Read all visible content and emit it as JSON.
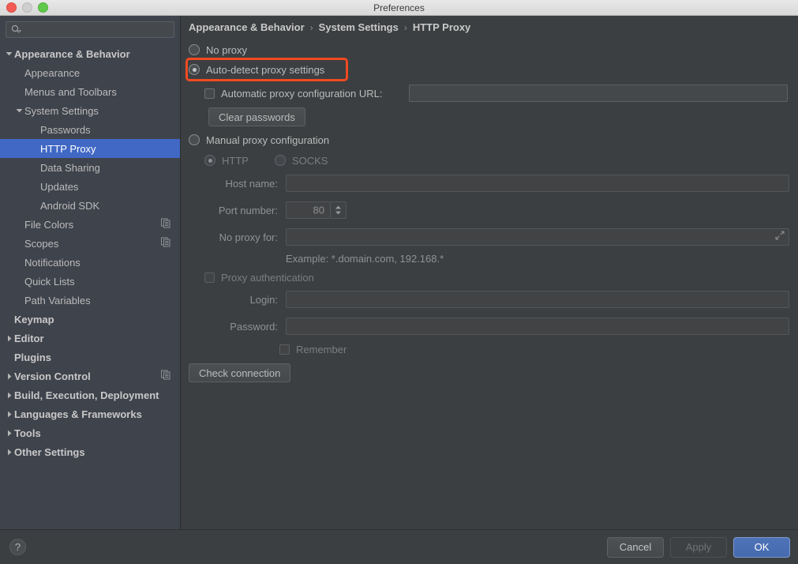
{
  "window": {
    "title": "Preferences",
    "traffic_lights": [
      "close-button",
      "minimize-button",
      "maximize-button"
    ]
  },
  "sidebar": {
    "search": {
      "placeholder": "",
      "value": "",
      "icon": "search-icon"
    },
    "items": [
      {
        "label": "Appearance & Behavior",
        "indent": 0,
        "bold": true,
        "twisty": "down",
        "selected": false,
        "badge": false
      },
      {
        "label": "Appearance",
        "indent": 1,
        "bold": false,
        "twisty": "none",
        "selected": false,
        "badge": false
      },
      {
        "label": "Menus and Toolbars",
        "indent": 1,
        "bold": false,
        "twisty": "none",
        "selected": false,
        "badge": false
      },
      {
        "label": "System Settings",
        "indent": 1,
        "bold": false,
        "twisty": "down",
        "selected": false,
        "badge": false
      },
      {
        "label": "Passwords",
        "indent": 2,
        "bold": false,
        "twisty": "none",
        "selected": false,
        "badge": false
      },
      {
        "label": "HTTP Proxy",
        "indent": 2,
        "bold": false,
        "twisty": "none",
        "selected": true,
        "badge": false
      },
      {
        "label": "Data Sharing",
        "indent": 2,
        "bold": false,
        "twisty": "none",
        "selected": false,
        "badge": false
      },
      {
        "label": "Updates",
        "indent": 2,
        "bold": false,
        "twisty": "none",
        "selected": false,
        "badge": false
      },
      {
        "label": "Android SDK",
        "indent": 2,
        "bold": false,
        "twisty": "none",
        "selected": false,
        "badge": false
      },
      {
        "label": "File Colors",
        "indent": 1,
        "bold": false,
        "twisty": "none",
        "selected": false,
        "badge": true
      },
      {
        "label": "Scopes",
        "indent": 1,
        "bold": false,
        "twisty": "none",
        "selected": false,
        "badge": true
      },
      {
        "label": "Notifications",
        "indent": 1,
        "bold": false,
        "twisty": "none",
        "selected": false,
        "badge": false
      },
      {
        "label": "Quick Lists",
        "indent": 1,
        "bold": false,
        "twisty": "none",
        "selected": false,
        "badge": false
      },
      {
        "label": "Path Variables",
        "indent": 1,
        "bold": false,
        "twisty": "none",
        "selected": false,
        "badge": false
      },
      {
        "label": "Keymap",
        "indent": 0,
        "bold": true,
        "twisty": "none",
        "selected": false,
        "badge": false
      },
      {
        "label": "Editor",
        "indent": 0,
        "bold": true,
        "twisty": "right",
        "selected": false,
        "badge": false
      },
      {
        "label": "Plugins",
        "indent": 0,
        "bold": true,
        "twisty": "none",
        "selected": false,
        "badge": false
      },
      {
        "label": "Version Control",
        "indent": 0,
        "bold": true,
        "twisty": "right",
        "selected": false,
        "badge": true
      },
      {
        "label": "Build, Execution, Deployment",
        "indent": 0,
        "bold": true,
        "twisty": "right",
        "selected": false,
        "badge": false
      },
      {
        "label": "Languages & Frameworks",
        "indent": 0,
        "bold": true,
        "twisty": "right",
        "selected": false,
        "badge": false
      },
      {
        "label": "Tools",
        "indent": 0,
        "bold": true,
        "twisty": "right",
        "selected": false,
        "badge": false
      },
      {
        "label": "Other Settings",
        "indent": 0,
        "bold": true,
        "twisty": "right",
        "selected": false,
        "badge": false
      }
    ]
  },
  "breadcrumb": {
    "separator": "›",
    "parts": [
      "Appearance & Behavior",
      "System Settings",
      "HTTP Proxy"
    ]
  },
  "proxy": {
    "no_proxy": {
      "label": "No proxy",
      "checked": false
    },
    "auto_detect": {
      "label": "Auto-detect proxy settings",
      "checked": true,
      "highlighted": true
    },
    "auto_config": {
      "label": "Automatic proxy configuration URL:",
      "checked": false,
      "url_value": "",
      "url_placeholder": ""
    },
    "clear_passwords_label": "Clear passwords",
    "manual": {
      "label": "Manual proxy configuration",
      "checked": false
    },
    "protocol": {
      "http": {
        "label": "HTTP",
        "checked": true
      },
      "socks": {
        "label": "SOCKS",
        "checked": false
      }
    },
    "host_name": {
      "label": "Host name:",
      "value": "",
      "placeholder": ""
    },
    "port_number": {
      "label": "Port number:",
      "value": "80"
    },
    "no_proxy_for": {
      "label": "No proxy for:",
      "value": "",
      "placeholder": "",
      "expand_icon": "expand-icon"
    },
    "example_text": "Example: *.domain.com, 192.168.*",
    "proxy_authentication": {
      "label": "Proxy authentication",
      "checked": false
    },
    "login": {
      "label": "Login:",
      "value": "",
      "placeholder": ""
    },
    "password": {
      "label": "Password:",
      "value": "",
      "placeholder": ""
    },
    "remember": {
      "label": "Remember",
      "checked": false
    },
    "check_connection_label": "Check connection"
  },
  "footer": {
    "help_label": "?",
    "cancel_label": "Cancel",
    "apply_label": "Apply",
    "ok_label": "OK"
  },
  "colors": {
    "selection_blue": "#4068c4",
    "primary_button": "#4e73b8",
    "highlight_orange": "#f04a22",
    "sidebar_bg": "#3f434c",
    "content_bg": "#3c3f41"
  }
}
